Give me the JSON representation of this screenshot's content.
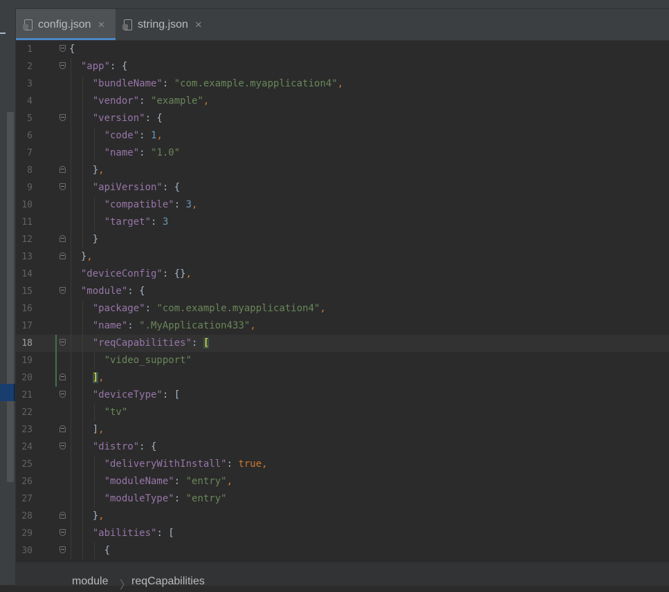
{
  "tabs": [
    {
      "label": "config.json",
      "active": true
    },
    {
      "label": "string.json",
      "active": false
    }
  ],
  "close_glyph": "×",
  "editor": {
    "current_line": 18,
    "lines": [
      {
        "n": "1",
        "fold": "open"
      },
      {
        "n": "2",
        "fold": "open"
      },
      {
        "n": "3"
      },
      {
        "n": "4"
      },
      {
        "n": "5",
        "fold": "open"
      },
      {
        "n": "6"
      },
      {
        "n": "7"
      },
      {
        "n": "8",
        "fold": "close"
      },
      {
        "n": "9",
        "fold": "open"
      },
      {
        "n": "10"
      },
      {
        "n": "11"
      },
      {
        "n": "12",
        "fold": "close"
      },
      {
        "n": "13",
        "fold": "close"
      },
      {
        "n": "14"
      },
      {
        "n": "15",
        "fold": "open"
      },
      {
        "n": "16"
      },
      {
        "n": "17"
      },
      {
        "n": "18",
        "fold": "open"
      },
      {
        "n": "19"
      },
      {
        "n": "20",
        "fold": "close"
      },
      {
        "n": "21",
        "fold": "open"
      },
      {
        "n": "22"
      },
      {
        "n": "23",
        "fold": "close"
      },
      {
        "n": "24",
        "fold": "open"
      },
      {
        "n": "25"
      },
      {
        "n": "26"
      },
      {
        "n": "27"
      },
      {
        "n": "28",
        "fold": "close"
      },
      {
        "n": "29",
        "fold": "open"
      },
      {
        "n": "30",
        "fold": "open"
      }
    ],
    "code": [
      [
        [
          "br",
          "{"
        ]
      ],
      [
        [
          "sp",
          "  "
        ],
        [
          "key",
          "\"app\""
        ],
        [
          "br",
          ": {"
        ]
      ],
      [
        [
          "sp",
          "    "
        ],
        [
          "key",
          "\"bundleName\""
        ],
        [
          "br",
          ": "
        ],
        [
          "str",
          "\"com.example.myapplication4\""
        ],
        [
          "comma",
          ","
        ]
      ],
      [
        [
          "sp",
          "    "
        ],
        [
          "key",
          "\"vendor\""
        ],
        [
          "br",
          ": "
        ],
        [
          "str",
          "\"example\""
        ],
        [
          "comma",
          ","
        ]
      ],
      [
        [
          "sp",
          "    "
        ],
        [
          "key",
          "\"version\""
        ],
        [
          "br",
          ": {"
        ]
      ],
      [
        [
          "sp",
          "      "
        ],
        [
          "key",
          "\"code\""
        ],
        [
          "br",
          ": "
        ],
        [
          "num",
          "1"
        ],
        [
          "comma",
          ","
        ]
      ],
      [
        [
          "sp",
          "      "
        ],
        [
          "key",
          "\"name\""
        ],
        [
          "br",
          ": "
        ],
        [
          "str",
          "\"1.0\""
        ]
      ],
      [
        [
          "sp",
          "    "
        ],
        [
          "br",
          "}"
        ],
        [
          "comma",
          ","
        ]
      ],
      [
        [
          "sp",
          "    "
        ],
        [
          "key",
          "\"apiVersion\""
        ],
        [
          "br",
          ": {"
        ]
      ],
      [
        [
          "sp",
          "      "
        ],
        [
          "key",
          "\"compatible\""
        ],
        [
          "br",
          ": "
        ],
        [
          "num",
          "3"
        ],
        [
          "comma",
          ","
        ]
      ],
      [
        [
          "sp",
          "      "
        ],
        [
          "key",
          "\"target\""
        ],
        [
          "br",
          ": "
        ],
        [
          "num",
          "3"
        ]
      ],
      [
        [
          "sp",
          "    "
        ],
        [
          "br",
          "}"
        ]
      ],
      [
        [
          "sp",
          "  "
        ],
        [
          "br",
          "}"
        ],
        [
          "comma",
          ","
        ]
      ],
      [
        [
          "sp",
          "  "
        ],
        [
          "key",
          "\"deviceConfig\""
        ],
        [
          "br",
          ": {}"
        ],
        [
          "comma",
          ","
        ]
      ],
      [
        [
          "sp",
          "  "
        ],
        [
          "key",
          "\"module\""
        ],
        [
          "br",
          ": {"
        ]
      ],
      [
        [
          "sp",
          "    "
        ],
        [
          "key",
          "\"package\""
        ],
        [
          "br",
          ": "
        ],
        [
          "str",
          "\"com.example.myapplication4\""
        ],
        [
          "comma",
          ","
        ]
      ],
      [
        [
          "sp",
          "    "
        ],
        [
          "key",
          "\"name\""
        ],
        [
          "br",
          ": "
        ],
        [
          "str",
          "\".MyApplication433\""
        ],
        [
          "comma",
          ","
        ]
      ],
      [
        [
          "sp",
          "    "
        ],
        [
          "key",
          "\"reqCapabilities\""
        ],
        [
          "br",
          ": "
        ],
        [
          "brm",
          "["
        ]
      ],
      [
        [
          "sp",
          "      "
        ],
        [
          "str",
          "\"video_support\""
        ]
      ],
      [
        [
          "sp",
          "    "
        ],
        [
          "brm",
          "]"
        ],
        [
          "comma",
          ","
        ]
      ],
      [
        [
          "sp",
          "    "
        ],
        [
          "key",
          "\"deviceType\""
        ],
        [
          "br",
          ": ["
        ]
      ],
      [
        [
          "sp",
          "      "
        ],
        [
          "str",
          "\"tv\""
        ]
      ],
      [
        [
          "sp",
          "    "
        ],
        [
          "br",
          "]"
        ],
        [
          "comma",
          ","
        ]
      ],
      [
        [
          "sp",
          "    "
        ],
        [
          "key",
          "\"distro\""
        ],
        [
          "br",
          ": {"
        ]
      ],
      [
        [
          "sp",
          "      "
        ],
        [
          "key",
          "\"deliveryWithInstall\""
        ],
        [
          "br",
          ": "
        ],
        [
          "kw",
          "true"
        ],
        [
          "comma",
          ","
        ]
      ],
      [
        [
          "sp",
          "      "
        ],
        [
          "key",
          "\"moduleName\""
        ],
        [
          "br",
          ": "
        ],
        [
          "str",
          "\"entry\""
        ],
        [
          "comma",
          ","
        ]
      ],
      [
        [
          "sp",
          "      "
        ],
        [
          "key",
          "\"moduleType\""
        ],
        [
          "br",
          ": "
        ],
        [
          "str",
          "\"entry\""
        ]
      ],
      [
        [
          "sp",
          "    "
        ],
        [
          "br",
          "}"
        ],
        [
          "comma",
          ","
        ]
      ],
      [
        [
          "sp",
          "    "
        ],
        [
          "key",
          "\"abilities\""
        ],
        [
          "br",
          ": ["
        ]
      ],
      [
        [
          "sp",
          "      "
        ],
        [
          "br",
          "{"
        ]
      ]
    ]
  },
  "breadcrumb": {
    "item1": "module",
    "separator": "〉",
    "item2": "reqCapabilities"
  },
  "colors": {
    "background": "#2b2b2b",
    "key": "#9876aa",
    "string": "#6a8759",
    "number": "#6897bb",
    "keyword": "#cc7832",
    "tab_underline": "#4a88c7"
  }
}
